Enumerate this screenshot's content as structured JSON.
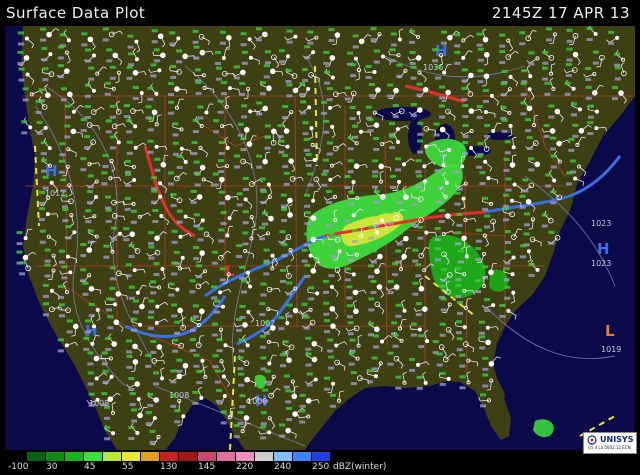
{
  "header": {
    "title": "Surface Data Plot",
    "timestamp": "2145Z 17 APR 13"
  },
  "colors": {
    "ocean": "#0a0a4a",
    "land": "#3f3f14",
    "border": "#b0402a",
    "radar_light": "#3ee03e",
    "radar_dark": "#14a014",
    "radar_yellow": "#e8e838",
    "cold_front": "#3a6fe8",
    "warm_front": "#e03030",
    "station": "#ffffff"
  },
  "map": {
    "pressure_labels": [
      "1036",
      "1023",
      "1023",
      "1019",
      "1012",
      "1008",
      "1008",
      "1000",
      "1002"
    ],
    "pressure_centers": [
      {
        "symbol": "H"
      },
      {
        "symbol": "H"
      },
      {
        "symbol": "H"
      },
      {
        "symbol": "H"
      },
      {
        "symbol": "L"
      },
      {
        "symbol": "L"
      },
      {
        "symbol": "H"
      }
    ]
  },
  "logo": {
    "name": "UNISYS",
    "sub": "(c) 4 La 0002:12 ECN"
  },
  "legend": {
    "unit": "dBZ(winter)",
    "bins": [
      {
        "label": "-100",
        "color": "#000000"
      },
      {
        "label": "",
        "color": "#0a6010"
      },
      {
        "label": "30",
        "color": "#108c10"
      },
      {
        "label": "",
        "color": "#18b418"
      },
      {
        "label": "45",
        "color": "#38e038"
      },
      {
        "label": "",
        "color": "#b8e838"
      },
      {
        "label": "55",
        "color": "#e8e838"
      },
      {
        "label": "",
        "color": "#e0a020"
      },
      {
        "label": "130",
        "color": "#c82020"
      },
      {
        "label": "",
        "color": "#a01818"
      },
      {
        "label": "145",
        "color": "#c84870"
      },
      {
        "label": "",
        "color": "#e070a0"
      },
      {
        "label": "220",
        "color": "#f090c0"
      },
      {
        "label": "",
        "color": "#d0d0d0"
      },
      {
        "label": "240",
        "color": "#80c0ff"
      },
      {
        "label": "",
        "color": "#4080ff"
      },
      {
        "label": "250",
        "color": "#2040e0"
      }
    ]
  }
}
